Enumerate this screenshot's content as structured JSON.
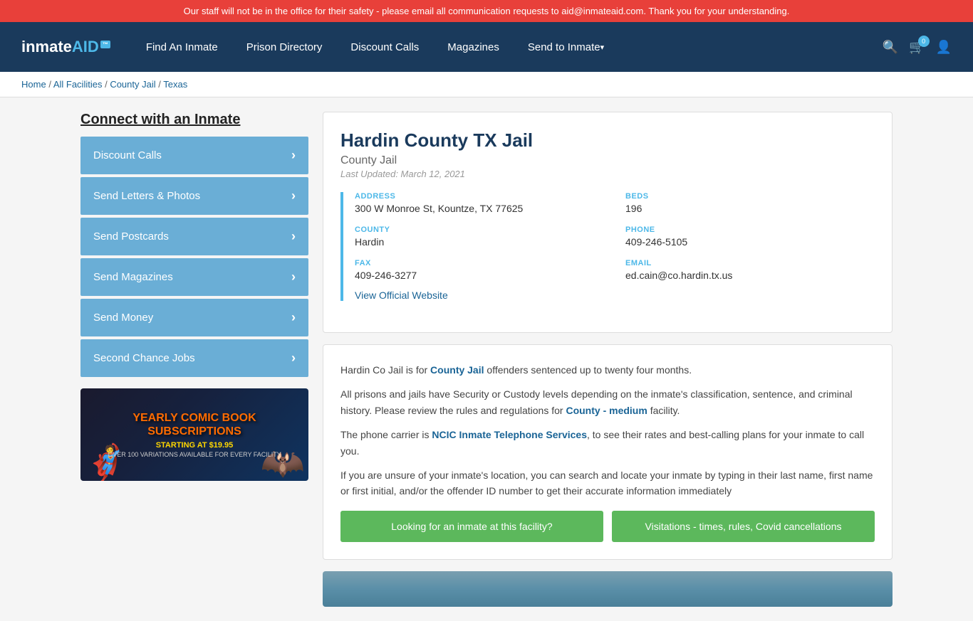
{
  "alert": {
    "message": "Our staff will not be in the office for their safety - please email all communication requests to aid@inmateaid.com. Thank you for your understanding."
  },
  "header": {
    "logo": {
      "text": "inmate",
      "aid": "AID",
      "badge": "™"
    },
    "nav": [
      {
        "label": "Find An Inmate",
        "id": "find-inmate",
        "hasArrow": false
      },
      {
        "label": "Prison Directory",
        "id": "prison-directory",
        "hasArrow": false
      },
      {
        "label": "Discount Calls",
        "id": "discount-calls",
        "hasArrow": false
      },
      {
        "label": "Magazines",
        "id": "magazines",
        "hasArrow": false
      },
      {
        "label": "Send to Inmate",
        "id": "send-to-inmate",
        "hasArrow": true
      }
    ],
    "cart_count": "0"
  },
  "breadcrumb": {
    "items": [
      "Home",
      "All Facilities",
      "County Jail",
      "Texas"
    ]
  },
  "sidebar": {
    "title": "Connect with an Inmate",
    "buttons": [
      {
        "label": "Discount Calls",
        "id": "btn-discount-calls"
      },
      {
        "label": "Send Letters & Photos",
        "id": "btn-letters"
      },
      {
        "label": "Send Postcards",
        "id": "btn-postcards"
      },
      {
        "label": "Send Magazines",
        "id": "btn-magazines"
      },
      {
        "label": "Send Money",
        "id": "btn-send-money"
      },
      {
        "label": "Second Chance Jobs",
        "id": "btn-jobs"
      }
    ],
    "ad": {
      "title": "YEARLY COMIC BOOK\nSUBSCRIPTIONS",
      "starting": "STARTING AT $19.95",
      "note": "OVER 100 VARIATIONS AVAILABLE FOR EVERY FACILITY"
    }
  },
  "facility": {
    "name": "Hardin County TX Jail",
    "type": "County Jail",
    "last_updated": "Last Updated: March 12, 2021",
    "address_label": "ADDRESS",
    "address_value": "300 W Monroe St, Kountze, TX 77625",
    "beds_label": "BEDS",
    "beds_value": "196",
    "county_label": "COUNTY",
    "county_value": "Hardin",
    "phone_label": "PHONE",
    "phone_value": "409-246-5105",
    "fax_label": "FAX",
    "fax_value": "409-246-3277",
    "email_label": "EMAIL",
    "email_value": "ed.cain@co.hardin.tx.us",
    "official_website_label": "View Official Website"
  },
  "description": {
    "para1_prefix": "Hardin Co Jail is for ",
    "para1_link": "County Jail",
    "para1_suffix": " offenders sentenced up to twenty four months.",
    "para2": "All prisons and jails have Security or Custody levels depending on the inmate's classification, sentence, and criminal history. Please review the rules and regulations for ",
    "para2_link": "County - medium",
    "para2_suffix": " facility.",
    "para3_prefix": "The phone carrier is ",
    "para3_link": "NCIC Inmate Telephone Services",
    "para3_suffix": ", to see their rates and best-calling plans for your inmate to call you.",
    "para4": "If you are unsure of your inmate's location, you can search and locate your inmate by typing in their last name, first name or first initial, and/or the offender ID number to get their accurate information immediately"
  },
  "action_buttons": {
    "btn1": "Looking for an inmate at this facility?",
    "btn2": "Visitations - times, rules, Covid cancellations"
  }
}
